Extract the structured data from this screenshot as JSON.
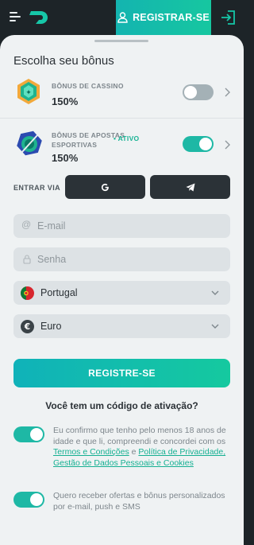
{
  "header": {
    "register_label": "REGISTRAR-SE"
  },
  "sheet": {
    "title": "Escolha seu bônus"
  },
  "bonuses": [
    {
      "name": "BÔNUS DE CASSINO",
      "value": "150%",
      "enabled": false,
      "icon": "casino-gem-icon"
    },
    {
      "name_line1": "BÔNUS DE APOSTAS",
      "name_line2": "ESPORTIVAS",
      "value": "150%",
      "badge": "ATIVO",
      "enabled": true,
      "icon": "sports-ball-icon"
    }
  ],
  "social": {
    "label": "ENTRAR VIA",
    "buttons": [
      "google-icon",
      "telegram-icon"
    ]
  },
  "form": {
    "email_placeholder": "E-mail",
    "password_placeholder": "Senha",
    "country_value": "Portugal",
    "currency_value": "Euro",
    "submit_label": "REGISTRE-SE",
    "promo_question": "Você tem um código de ativação?"
  },
  "consents": {
    "age": {
      "text_before": "Eu confirmo que tenho pelo menos 18 anos de idade e que li, compreendi e concordei com os ",
      "link1": "Termos e Condições",
      "text_mid": " e ",
      "link2": "Política de Privacidade, Gestão de Dados Pessoais e Cookies",
      "enabled": true
    },
    "marketing": {
      "text": "Quero receber ofertas e bônus personalizados por e-mail, push e SMS",
      "enabled": true
    }
  },
  "colors": {
    "accent": "#1eb8a5",
    "dark": "#1d2428",
    "sheet": "#eff2f3"
  }
}
